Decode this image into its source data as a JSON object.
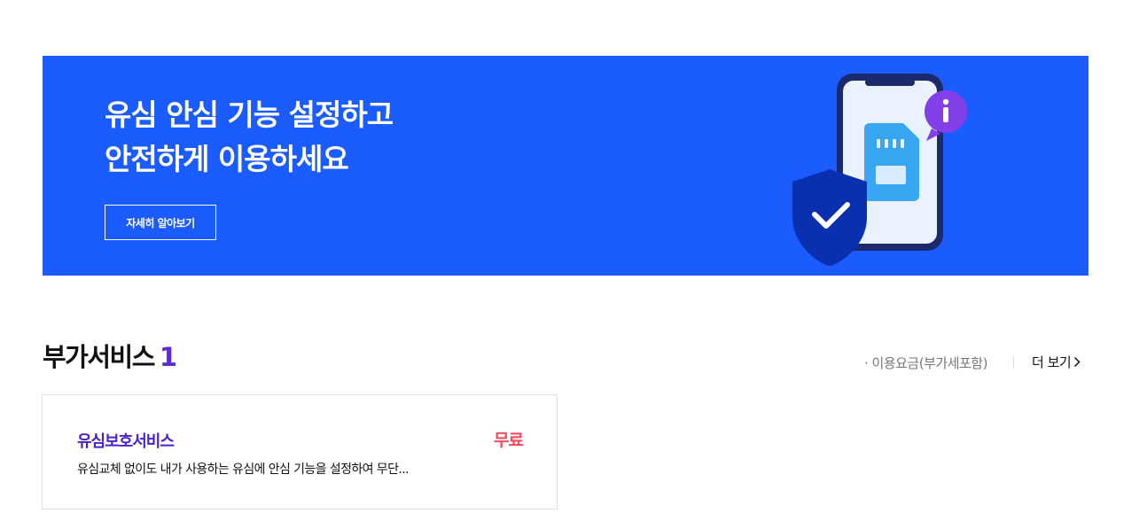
{
  "banner": {
    "title_line1": "유심 안심 기능 설정하고",
    "title_line2": "안전하게 이용하세요",
    "button_label": "자세히 알아보기",
    "background_color": "#1a5cff"
  },
  "illustration": {
    "icons": [
      "smartphone-icon",
      "sim-card-icon",
      "info-icon",
      "shield-check-icon"
    ]
  },
  "section": {
    "title": "부가서비스",
    "count": "1",
    "fee_note": "· 이용요금(부가세포함)",
    "more_label": "더 보기"
  },
  "services": [
    {
      "name": "유심보호서비스",
      "price": "무료",
      "description": "유심교체 없이도 내가 사용하는 유심에 안심 기능을 설정하여 무단..."
    }
  ],
  "colors": {
    "accent": "#5b2bd6",
    "price": "#f24a5a",
    "service_name": "#4a1fcf"
  }
}
